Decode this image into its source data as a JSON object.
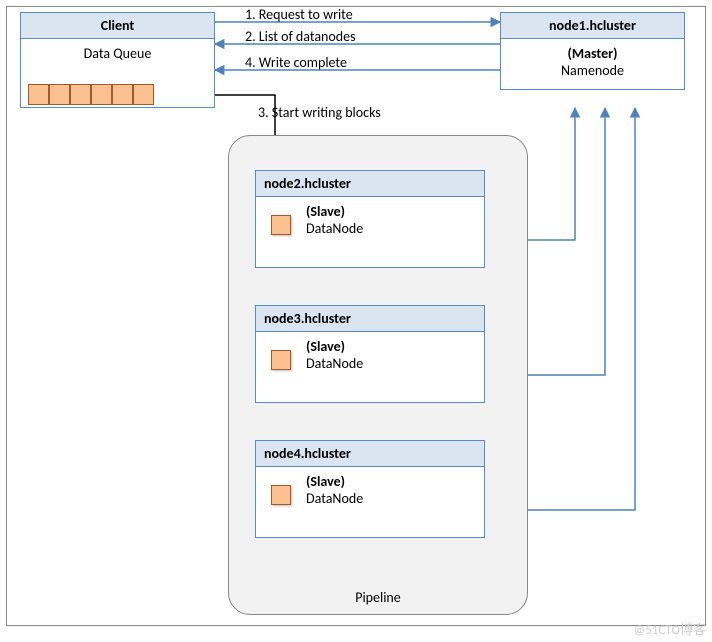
{
  "client": {
    "title": "Client",
    "queue_label": "Data Queue"
  },
  "master": {
    "title": "node1.hcluster",
    "role": "(Master)",
    "daemon": "Namenode"
  },
  "pipeline": {
    "label": "Pipeline",
    "nodes": [
      {
        "title": "node2.hcluster",
        "role": "(Slave)",
        "daemon": "DataNode"
      },
      {
        "title": "node3.hcluster",
        "role": "(Slave)",
        "daemon": "DataNode"
      },
      {
        "title": "node4.hcluster",
        "role": "(Slave)",
        "daemon": "DataNode"
      }
    ]
  },
  "arrows": {
    "a1": "1. Request to write",
    "a2": "2. List of datanodes",
    "a3": "3. Start writing blocks",
    "a4": "4. Write complete"
  },
  "watermark": "@51CTO博客"
}
